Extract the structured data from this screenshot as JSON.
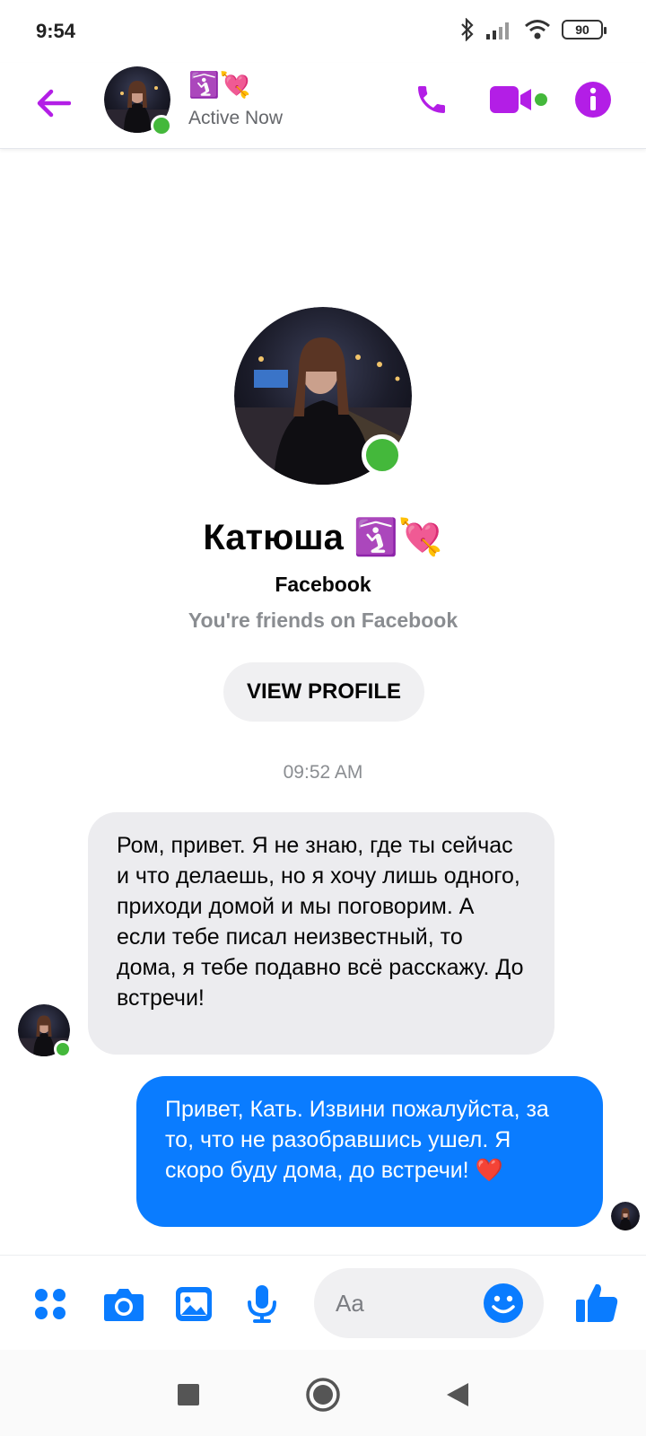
{
  "status_bar": {
    "time": "9:54",
    "battery": "90"
  },
  "header": {
    "contact_name": "🛐💘",
    "status": "Active Now"
  },
  "profile": {
    "name": "Катюша 🛐💘",
    "subtitle": "Facebook",
    "friends_text": "You're friends on Facebook",
    "view_profile_label": "VIEW PROFILE"
  },
  "conversation": {
    "timestamp": "09:52 AM",
    "incoming_message": "Ром, привет. Я не знаю, где ты сейчас и что делаешь, но я хочу лишь одного, приходи домой и мы поговорим. А если тебе писал неизвестный, то дома, я тебе подавно всё расскажу. До встречи!",
    "outgoing_message": "Привет, Кать. Извини пожалуйста, за то, что не разобравшись ушел. Я скоро буду дома, до встречи! ❤️"
  },
  "composer": {
    "placeholder": "Aa"
  },
  "colors": {
    "header_accent": "#b31ee6",
    "composer_accent": "#0a7cff",
    "outgoing_bubble": "#0a7cff",
    "incoming_bubble": "#ececef",
    "online": "#44b83b"
  },
  "icons": {
    "header": [
      "back-arrow-icon",
      "phone-icon",
      "video-camera-icon",
      "info-icon"
    ],
    "composer": [
      "menu-dots-icon",
      "camera-icon",
      "gallery-icon",
      "microphone-icon",
      "emoji-icon",
      "thumbs-up-icon"
    ],
    "nav": [
      "recents-icon",
      "home-icon",
      "back-icon"
    ]
  }
}
